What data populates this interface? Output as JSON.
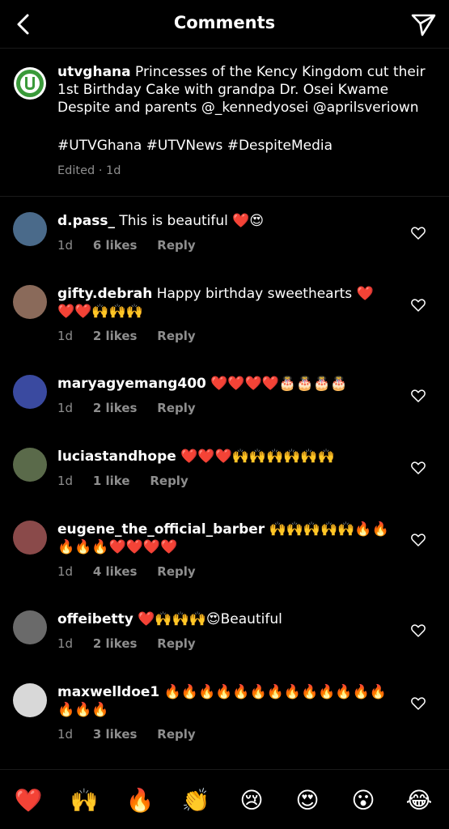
{
  "header": {
    "title": "Comments",
    "back_icon": "chevron-left-icon",
    "send_icon": "paper-plane-icon"
  },
  "caption": {
    "username": "utvghana",
    "text": "Princesses of the Kency Kingdom cut their 1st Birthday Cake with grandpa Dr. Osei Kwame Despite and parents @_kennedyosei @aprilsveriown",
    "hashtags": "#UTVGhana #UTVNews #DespiteMedia",
    "meta": "Edited · 1d",
    "avatar_color": "#3a9a3a"
  },
  "comments": [
    {
      "username": "d.pass_",
      "text": "This is beautiful ❤️😍",
      "time": "1d",
      "likes": "6 likes",
      "reply": "Reply",
      "avatar_color": "#4a6a8a"
    },
    {
      "username": "gifty.debrah",
      "text": "Happy birthday sweethearts ❤️❤️❤️🙌🙌🙌",
      "time": "1d",
      "likes": "2 likes",
      "reply": "Reply",
      "avatar_color": "#8a6a5a"
    },
    {
      "username": "maryagyemang400",
      "text": "❤️❤️❤️❤️🎂🎂🎂🎂",
      "time": "1d",
      "likes": "2 likes",
      "reply": "Reply",
      "avatar_color": "#3a4aa0"
    },
    {
      "username": "luciastandhope",
      "text": "❤️❤️❤️🙌🙌🙌🙌🙌🙌",
      "time": "1d",
      "likes": "1 like",
      "reply": "Reply",
      "avatar_color": "#5a6a4a"
    },
    {
      "username": "eugene_the_official_barber",
      "text": "🙌🙌🙌🙌🙌🔥🔥🔥🔥🔥❤️❤️❤️❤️",
      "time": "1d",
      "likes": "4 likes",
      "reply": "Reply",
      "avatar_color": "#8a4a4a"
    },
    {
      "username": "offeibetty",
      "text": "❤️🙌🙌🙌😍Beautiful",
      "time": "1d",
      "likes": "2 likes",
      "reply": "Reply",
      "avatar_color": "#6a6a6a"
    },
    {
      "username": "maxwelldoe1",
      "text": "🔥🔥🔥🔥🔥🔥🔥🔥🔥🔥🔥🔥🔥🔥🔥🔥",
      "time": "1d",
      "likes": "3 likes",
      "reply": "Reply",
      "avatar_color": "#d8d8d8"
    }
  ],
  "emoji_bar": [
    "❤️",
    "🙌",
    "🔥",
    "👏",
    "😢",
    "😍",
    "😮",
    "😂"
  ]
}
